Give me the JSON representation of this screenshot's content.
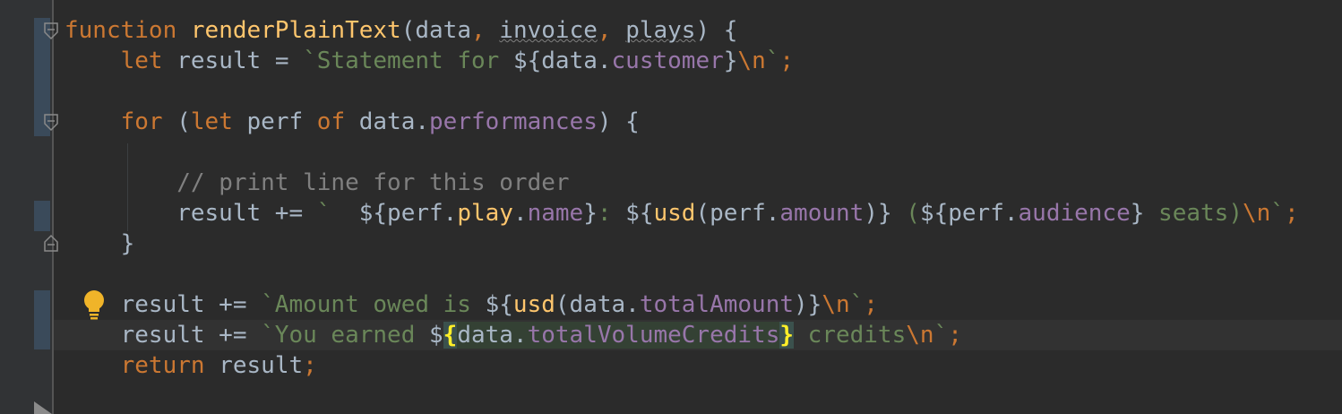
{
  "editor": {
    "lines": [
      {
        "tokens": [
          {
            "t": "function",
            "c": "kw"
          },
          {
            "t": " ",
            "c": ""
          },
          {
            "t": "renderPlainText",
            "c": "fn"
          },
          {
            "t": "(data",
            "c": ""
          },
          {
            "t": ", ",
            "c": "kw"
          },
          {
            "t": "invoice",
            "c": "param-unused"
          },
          {
            "t": ", ",
            "c": "kw"
          },
          {
            "t": "plays",
            "c": "param-unused"
          },
          {
            "t": ") {",
            "c": ""
          }
        ]
      },
      {
        "tokens": [
          {
            "t": "    ",
            "c": ""
          },
          {
            "t": "let",
            "c": "kw"
          },
          {
            "t": " result = ",
            "c": ""
          },
          {
            "t": "`Statement for ",
            "c": "str"
          },
          {
            "t": "${data.",
            "c": ""
          },
          {
            "t": "customer",
            "c": "prop"
          },
          {
            "t": "}",
            "c": ""
          },
          {
            "t": "\\n",
            "c": "kw"
          },
          {
            "t": "`",
            "c": "str"
          },
          {
            "t": ";",
            "c": "kw"
          }
        ]
      },
      {
        "tokens": []
      },
      {
        "tokens": [
          {
            "t": "    ",
            "c": ""
          },
          {
            "t": "for",
            "c": "kw"
          },
          {
            "t": " (",
            "c": ""
          },
          {
            "t": "let",
            "c": "kw"
          },
          {
            "t": " perf ",
            "c": ""
          },
          {
            "t": "of",
            "c": "kw"
          },
          {
            "t": " data.",
            "c": ""
          },
          {
            "t": "performances",
            "c": "prop"
          },
          {
            "t": ") {",
            "c": ""
          }
        ]
      },
      {
        "tokens": []
      },
      {
        "tokens": [
          {
            "t": "        ",
            "c": ""
          },
          {
            "t": "// print line for this order",
            "c": "cm"
          }
        ]
      },
      {
        "tokens": [
          {
            "t": "        result += ",
            "c": ""
          },
          {
            "t": "`  ",
            "c": "str"
          },
          {
            "t": "${perf.",
            "c": ""
          },
          {
            "t": "play",
            "c": "fn"
          },
          {
            "t": ".",
            "c": ""
          },
          {
            "t": "name",
            "c": "prop"
          },
          {
            "t": "}",
            "c": ""
          },
          {
            "t": ": ",
            "c": "str"
          },
          {
            "t": "${",
            "c": ""
          },
          {
            "t": "usd",
            "c": "fn"
          },
          {
            "t": "(perf.",
            "c": ""
          },
          {
            "t": "amount",
            "c": "prop"
          },
          {
            "t": ")}",
            "c": ""
          },
          {
            "t": " (",
            "c": "str"
          },
          {
            "t": "${perf.",
            "c": ""
          },
          {
            "t": "audience",
            "c": "prop"
          },
          {
            "t": "}",
            "c": ""
          },
          {
            "t": " seats)",
            "c": "str"
          },
          {
            "t": "\\n",
            "c": "kw"
          },
          {
            "t": "`",
            "c": "str"
          },
          {
            "t": ";",
            "c": "kw"
          }
        ]
      },
      {
        "tokens": [
          {
            "t": "    }",
            "c": ""
          }
        ]
      },
      {
        "tokens": []
      },
      {
        "tokens": [
          {
            "t": "    result += ",
            "c": ""
          },
          {
            "t": "`Amount owed is ",
            "c": "str"
          },
          {
            "t": "${",
            "c": ""
          },
          {
            "t": "usd",
            "c": "fn"
          },
          {
            "t": "(data.",
            "c": ""
          },
          {
            "t": "totalAmount",
            "c": "prop"
          },
          {
            "t": ")}",
            "c": ""
          },
          {
            "t": "\\n",
            "c": "kw"
          },
          {
            "t": "`",
            "c": "str"
          },
          {
            "t": ";",
            "c": "kw"
          }
        ]
      },
      {
        "tokens": [
          {
            "t": "    result += ",
            "c": ""
          },
          {
            "t": "`You earned ",
            "c": "str"
          },
          {
            "t": "$",
            "c": ""
          },
          {
            "t": "{",
            "c": "brace-match"
          },
          {
            "t": "data.",
            "c": "hl-prop"
          },
          {
            "t": "totalVolumeCredits",
            "c": "prop hl-prop"
          },
          {
            "t": "}",
            "c": "brace-match"
          },
          {
            "t": " credits",
            "c": "str"
          },
          {
            "t": "\\n",
            "c": "kw"
          },
          {
            "t": "`",
            "c": "str"
          },
          {
            "t": ";",
            "c": "kw"
          }
        ]
      },
      {
        "tokens": [
          {
            "t": "    ",
            "c": ""
          },
          {
            "t": "return",
            "c": "kw"
          },
          {
            "t": " result",
            "c": ""
          },
          {
            "t": ";",
            "c": "kw"
          }
        ]
      }
    ]
  },
  "icons": {
    "intention_bulb": "lightbulb-icon",
    "fold_open": "fold-open-icon",
    "fold_close": "fold-close-icon"
  },
  "colors": {
    "background": "#2b2b2b",
    "keyword": "#cc7832",
    "function": "#ffc66d",
    "string": "#6a8759",
    "property": "#9876aa",
    "comment": "#808080",
    "default": "#a9b7c6"
  }
}
